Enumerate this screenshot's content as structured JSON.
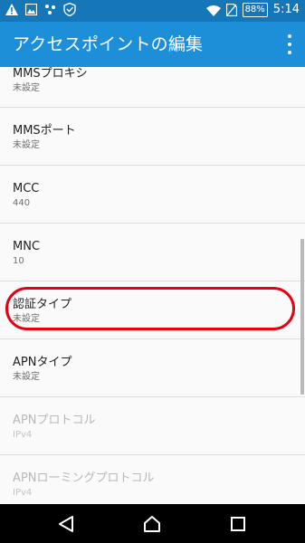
{
  "status_bar": {
    "icons_left": [
      "warning-icon",
      "image-icon",
      "dots-icon",
      "shield-icon"
    ],
    "icons_right": [
      "wifi-icon",
      "no-sim-icon"
    ],
    "battery": "88%",
    "time": "5:14"
  },
  "app_bar": {
    "title": "アクセスポイントの編集",
    "overflow_icon": "more-vert-icon"
  },
  "list": {
    "items": [
      {
        "title": "MMSプロキシ",
        "value": "未設定",
        "enabled": true
      },
      {
        "title": "MMSポート",
        "value": "未設定",
        "enabled": true
      },
      {
        "title": "MCC",
        "value": "440",
        "enabled": true
      },
      {
        "title": "MNC",
        "value": "10",
        "enabled": true
      },
      {
        "title": "認証タイプ",
        "value": "未設定",
        "enabled": true
      },
      {
        "title": "APNタイプ",
        "value": "未設定",
        "enabled": true
      },
      {
        "title": "APNプロトコル",
        "value": "IPv4",
        "enabled": false
      },
      {
        "title": "APNローミングプロトコル",
        "value": "IPv4",
        "enabled": false
      }
    ]
  },
  "annotation": {
    "color": "#e60012",
    "target": "認証タイプ"
  },
  "nav_bar": {
    "icons": [
      "back-icon",
      "home-icon",
      "recents-icon"
    ]
  },
  "colors": {
    "status_bar": "#1677b8",
    "app_bar": "#1c8fd8",
    "list_bg": "#fafafa"
  }
}
